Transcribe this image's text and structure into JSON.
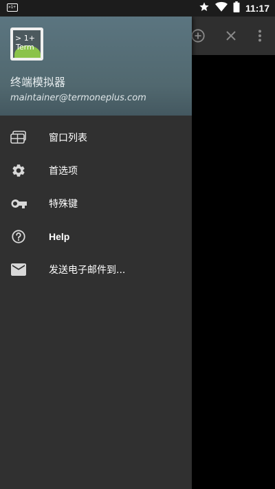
{
  "status_bar": {
    "app_badge": ">1+",
    "time": "11:17",
    "icons": [
      "star-icon",
      "wifi-icon",
      "battery-icon"
    ]
  },
  "toolbar": {
    "icons": [
      "add-circle-icon",
      "close-icon",
      "more-vert-icon"
    ]
  },
  "drawer": {
    "header": {
      "icon_line1": "> 1+",
      "icon_line2": "Term",
      "title": "终端模拟器",
      "email": "maintainer@termoneplus.com"
    },
    "items": [
      {
        "label": "窗口列表",
        "icon": "window-list-icon"
      },
      {
        "label": "首选项",
        "icon": "gear-icon"
      },
      {
        "label": "特殊键",
        "icon": "key-icon"
      },
      {
        "label": "Help",
        "icon": "help-icon"
      },
      {
        "label": "发送电子邮件到...",
        "icon": "mail-icon"
      }
    ]
  },
  "colors": {
    "drawer_bg": "#303030",
    "header_bg": "#5b7580",
    "toolbar_bg": "#2f2f2f",
    "status_bar_bg": "#1c1c1c",
    "text": "#ffffff",
    "icon_green": "#8bc34a"
  }
}
